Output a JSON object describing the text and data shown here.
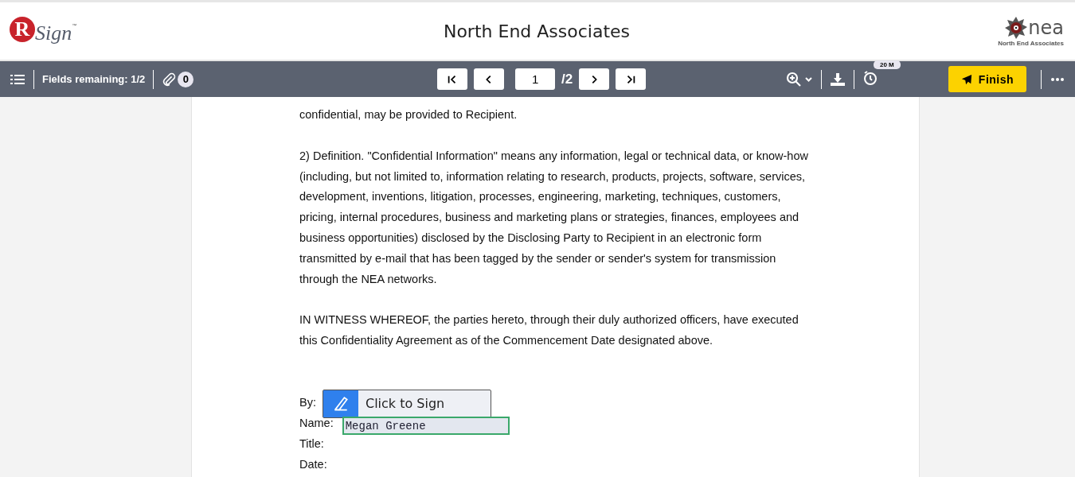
{
  "header": {
    "logo_left": {
      "letter": "R",
      "word": "Sign",
      "mark": "™"
    },
    "title": "North End Associates",
    "logo_right": {
      "word": "nea",
      "caption": "North End Associates"
    }
  },
  "toolbar": {
    "fields_remaining": "Fields remaining: 1/2",
    "attachments": "0",
    "page": "1",
    "page_total": "/2",
    "timer": "20 M",
    "finish": "Finish"
  },
  "document": {
    "paragraphs": [
      "confidential, may be provided to Recipient.",
      "2) Definition.  \"Confidential Information\" means any information, legal or technical data, or know-how (including, but not limited to, information relating to research, products, projects, software, services, development, inventions, litigation, processes, engineering, marketing, techniques, customers, pricing, internal procedures, business and marketing plans or strategies, finances, employees and business opportunities) disclosed by the Disclosing Party to Recipient in an electronic form transmitted by e-mail that has been tagged by the sender or sender's system for transmission through the NEA networks.",
      "IN WITNESS WHEREOF, the parties hereto, through their duly authorized officers, have executed this Confidentiality Agreement as of the Commencement Date designated above."
    ],
    "signature": [
      {
        "kind": "sign",
        "label": "By:",
        "value": "Click to Sign"
      },
      {
        "kind": "name",
        "label": "Name:",
        "value": "Megan Greene"
      },
      {
        "kind": "text",
        "label": "Title:"
      },
      {
        "kind": "text",
        "label": "Date:"
      }
    ]
  }
}
